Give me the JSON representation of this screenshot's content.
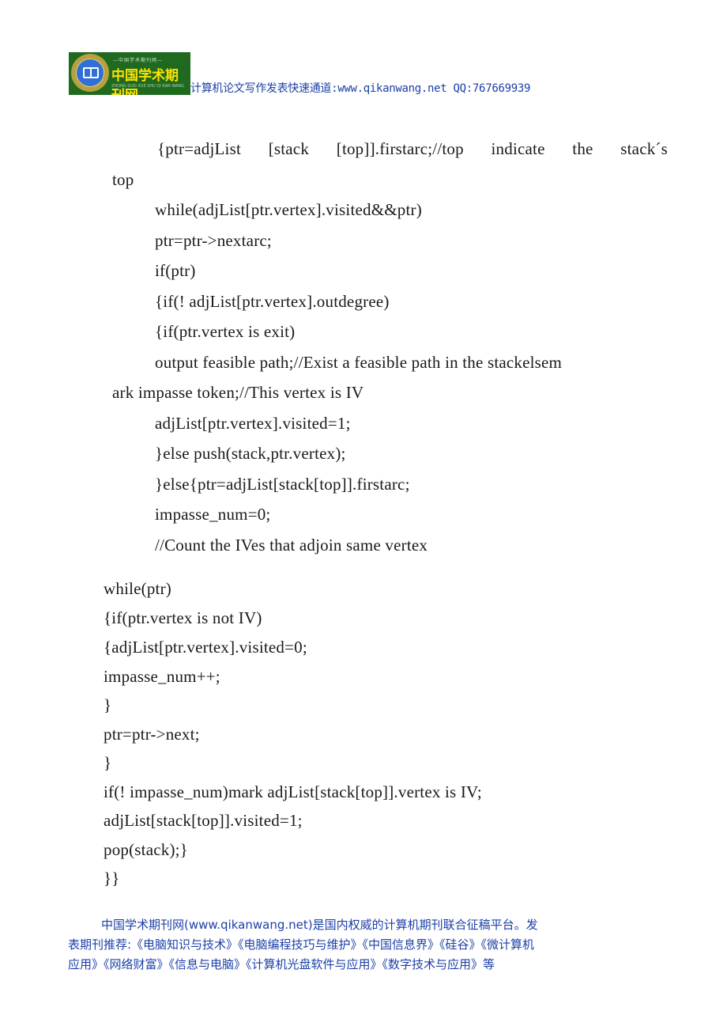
{
  "header": {
    "logo": {
      "top_text": "—中国学术期刊网—",
      "name": "中国学术期刊网",
      "sub_text": "ZHONG GUO XUE SHU QI KAN WANG"
    },
    "tagline": "计算机论文写作发表快速通道:www.qikanwang.net QQ:767669939"
  },
  "code_lines": [
    "{ptr=adjList [stack [top]].firstarc;//top  indicate  the  stack´s",
    "top",
    "while(adjList[ptr.vertex].visited&&ptr)",
    "ptr=ptr->nextarc;",
    "if(ptr)",
    "{if(!  adjList[ptr.vertex].outdegree)",
    "{if(ptr.vertex is exit)",
    "output feasible path;//Exist a feasible path in the stackelsem",
    "ark impasse token;//This vertex is IV",
    "adjList[ptr.vertex].visited=1;",
    "}else push(stack,ptr.vertex);",
    "}else{ptr=adjList[stack[top]].firstarc;",
    "impasse_num=0;",
    "//Count the IVes that adjoin same vertex",
    "while(ptr)",
    "{if(ptr.vertex is not IV)",
    "{adjList[ptr.vertex].visited=0;",
    "impasse_num++;",
    "}",
    "ptr=ptr->next;",
    "}",
    "if(!  impasse_num)mark adjList[stack[top]].vertex is IV;",
    "adjList[stack[top]].visited=1;",
    "pop(stack);}",
    "}}"
  ],
  "footer": {
    "lines": [
      "中国学术期刊网(www.qikanwang.net)是国内权威的计算机期刊联合征稿平台。发",
      "表期刊推荐:《电脑知识与技术》《电脑编程技巧与维护》《中国信息界》《硅谷》《微计算机",
      "应用》《网络财富》《信息与电脑》《计算机光盘软件与应用》《数字技术与应用》等"
    ]
  }
}
